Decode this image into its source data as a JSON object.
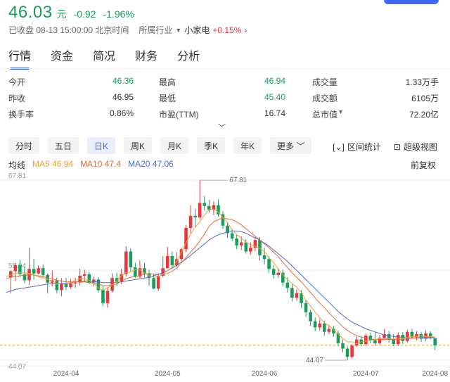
{
  "header": {
    "price": "46.03",
    "unit": "元",
    "change": "-0.92",
    "change_pct": "-1.96%",
    "status": "已收盘 08-13 15:00:00 北京时间",
    "industry_label": "所属行业",
    "industry_name": "小家电",
    "industry_change": "+0.15%"
  },
  "tabs": [
    "行情",
    "资金",
    "简况",
    "财务",
    "分析"
  ],
  "stats": [
    [
      {
        "label": "今开",
        "value": "46.36",
        "color": "green"
      },
      {
        "label": "最高",
        "value": "46.94",
        "color": "green"
      },
      {
        "label": "成交量",
        "value": "1.33万手",
        "color": ""
      }
    ],
    [
      {
        "label": "昨收",
        "value": "46.95",
        "color": ""
      },
      {
        "label": "最低",
        "value": "45.40",
        "color": "green"
      },
      {
        "label": "成交额",
        "value": "6105万",
        "color": ""
      }
    ],
    [
      {
        "label": "换手率",
        "value": "0.86%",
        "color": ""
      },
      {
        "label": "市盈(TTM)",
        "value": "16.74",
        "color": ""
      },
      {
        "label": "总市值",
        "value": "72.20亿",
        "color": ""
      }
    ]
  ],
  "expand_icon": "chevron-down",
  "periods": [
    "分时",
    "五日",
    "日K",
    "周K",
    "月K",
    "季K",
    "年K",
    "更多"
  ],
  "active_period": "日K",
  "tools": {
    "interval_stats": "区间统计",
    "super_view": "超级视图"
  },
  "legend": {
    "title": "均线",
    "ma5": "MA5 46.94",
    "ma10": "MA10 47.4",
    "ma20": "MA20 47.06",
    "adjust": "前复权"
  },
  "colors": {
    "up": "#e8373d",
    "down": "#1a9d5c",
    "ma5": "#e9a23b",
    "ma10": "#e8673d",
    "ma20": "#4b6bd6",
    "accent": "#3e66f3"
  },
  "chart_data": {
    "type": "candlestick",
    "y_range": [
      44.07,
      67.81
    ],
    "y_labels": [
      "67.81",
      "55.94",
      "44.07"
    ],
    "reference_line": 46.03,
    "max_marker": "67.81",
    "min_marker": "44.07",
    "x_ticks": [
      "2024-04",
      "2024-05",
      "2024-06",
      "2024-07",
      "2024-08"
    ],
    "candles": [
      [
        55.0,
        55.8,
        53.2,
        52.9,
        55.9
      ],
      [
        55.8,
        56.6,
        55.0,
        54.5,
        56.9
      ],
      [
        56.6,
        55.4,
        56.7,
        55.0,
        57.3
      ],
      [
        55.4,
        54.6,
        55.8,
        54.2,
        56.4
      ],
      [
        54.6,
        56.1,
        54.4,
        54.0,
        58.9
      ],
      [
        56.1,
        55.5,
        56.4,
        54.7,
        57.4
      ],
      [
        55.5,
        56.2,
        55.9,
        55.4,
        56.6
      ],
      [
        56.2,
        55.3,
        56.4,
        55.0,
        56.7
      ],
      [
        55.3,
        54.3,
        55.4,
        52.9,
        55.5
      ],
      [
        54.3,
        54.6,
        54.0,
        53.8,
        55.9
      ],
      [
        54.6,
        53.3,
        54.8,
        52.9,
        55.0
      ],
      [
        53.3,
        54.1,
        53.1,
        52.5,
        54.9
      ],
      [
        54.1,
        53.7,
        54.2,
        53.3,
        54.9
      ],
      [
        53.7,
        54.2,
        53.8,
        53.5,
        54.8
      ],
      [
        54.2,
        54.3,
        54.5,
        53.6,
        54.9
      ],
      [
        54.3,
        55.2,
        54.2,
        53.9,
        56.1
      ],
      [
        55.2,
        55.4,
        55.3,
        54.5,
        56.0
      ],
      [
        55.4,
        54.3,
        55.5,
        54.1,
        55.7
      ],
      [
        54.3,
        54.7,
        54.3,
        53.8,
        55.1
      ],
      [
        54.7,
        53.3,
        54.8,
        53.0,
        55.0
      ],
      [
        53.3,
        51.6,
        53.6,
        51.2,
        53.9
      ],
      [
        51.6,
        53.2,
        51.4,
        51.0,
        53.7
      ],
      [
        53.2,
        54.9,
        53.3,
        53.0,
        55.5
      ],
      [
        54.9,
        54.4,
        55.1,
        53.8,
        55.6
      ],
      [
        54.4,
        55.4,
        54.5,
        54.1,
        56.1
      ],
      [
        55.4,
        58.4,
        55.5,
        55.1,
        59.1
      ],
      [
        58.4,
        56.3,
        58.5,
        55.8,
        58.8
      ],
      [
        56.3,
        55.1,
        56.1,
        54.9,
        56.9
      ],
      [
        55.1,
        56.2,
        55.2,
        54.9,
        57.2
      ],
      [
        56.2,
        55.5,
        56.0,
        55.0,
        56.9
      ],
      [
        55.5,
        54.9,
        55.6,
        53.9,
        56.0
      ],
      [
        54.9,
        53.5,
        55.0,
        53.4,
        55.4
      ],
      [
        53.5,
        55.2,
        53.6,
        53.2,
        55.5
      ],
      [
        55.2,
        56.2,
        55.4,
        55.0,
        57.8
      ],
      [
        56.2,
        57.8,
        56.4,
        56.2,
        59.0
      ],
      [
        57.8,
        56.6,
        57.9,
        56.2,
        58.4
      ],
      [
        56.6,
        57.4,
        56.8,
        56.4,
        58.3
      ],
      [
        57.4,
        58.7,
        57.5,
        57.1,
        58.9
      ],
      [
        58.7,
        61.5,
        58.9,
        58.3,
        61.9
      ],
      [
        61.5,
        63.1,
        61.7,
        60.8,
        64.5
      ],
      [
        63.1,
        62.9,
        63.0,
        61.6,
        64.0
      ],
      [
        62.9,
        64.8,
        62.9,
        62.6,
        67.8
      ],
      [
        64.8,
        64.4,
        65.0,
        63.8,
        65.7
      ],
      [
        64.4,
        63.9,
        64.6,
        63.5,
        65.2
      ],
      [
        63.9,
        64.5,
        63.8,
        63.2,
        65.0
      ],
      [
        64.5,
        63.3,
        64.7,
        63.0,
        65.3
      ],
      [
        63.3,
        61.8,
        63.4,
        61.4,
        63.7
      ],
      [
        61.8,
        60.8,
        62.0,
        60.2,
        62.3
      ],
      [
        60.8,
        60.1,
        61.0,
        59.8,
        61.4
      ],
      [
        60.1,
        59.2,
        60.3,
        58.7,
        60.6
      ],
      [
        59.2,
        59.6,
        59.1,
        58.6,
        60.4
      ],
      [
        59.6,
        58.4,
        59.7,
        58.1,
        60.0
      ],
      [
        58.4,
        58.9,
        58.6,
        58.0,
        59.6
      ],
      [
        58.9,
        59.9,
        58.8,
        58.4,
        60.3
      ],
      [
        59.9,
        57.9,
        60.0,
        57.2,
        60.3
      ],
      [
        57.9,
        57.4,
        58.1,
        56.7,
        58.9
      ],
      [
        57.4,
        56.1,
        57.6,
        55.6,
        57.8
      ],
      [
        56.1,
        55.3,
        56.3,
        54.8,
        56.6
      ],
      [
        55.3,
        55.6,
        55.4,
        54.9,
        56.2
      ],
      [
        55.6,
        54.3,
        55.7,
        53.8,
        56.0
      ],
      [
        54.3,
        53.6,
        54.5,
        53.0,
        55.0
      ],
      [
        53.6,
        52.3,
        53.8,
        51.8,
        54.1
      ],
      [
        52.3,
        52.9,
        52.2,
        51.9,
        53.4
      ],
      [
        52.9,
        51.6,
        53.0,
        51.0,
        53.3
      ],
      [
        51.6,
        50.4,
        51.8,
        49.8,
        52.0
      ],
      [
        50.4,
        49.2,
        50.6,
        48.6,
        50.7
      ],
      [
        49.2,
        48.4,
        49.4,
        47.9,
        49.7
      ],
      [
        48.4,
        48.9,
        48.3,
        48.0,
        49.5
      ],
      [
        48.9,
        47.8,
        49.0,
        47.3,
        49.3
      ],
      [
        47.8,
        48.2,
        47.9,
        47.5,
        48.7
      ],
      [
        48.2,
        47.6,
        48.3,
        47.2,
        48.6
      ],
      [
        47.6,
        46.3,
        47.8,
        45.9,
        48.0
      ],
      [
        46.3,
        45.6,
        46.5,
        45.1,
        46.8
      ],
      [
        45.6,
        44.5,
        45.8,
        44.07,
        45.9
      ],
      [
        44.5,
        46.0,
        44.6,
        44.3,
        46.2
      ],
      [
        46.0,
        46.8,
        46.1,
        45.8,
        47.2
      ],
      [
        46.8,
        46.2,
        46.9,
        45.9,
        47.3
      ],
      [
        46.2,
        47.3,
        46.3,
        46.0,
        47.6
      ],
      [
        47.3,
        46.7,
        47.4,
        46.3,
        47.7
      ],
      [
        46.7,
        46.3,
        46.9,
        46.0,
        47.8
      ],
      [
        46.3,
        47.0,
        46.4,
        46.1,
        47.4
      ],
      [
        47.0,
        47.5,
        47.2,
        46.8,
        48.2
      ],
      [
        47.5,
        46.8,
        47.6,
        46.4,
        47.9
      ],
      [
        46.8,
        46.2,
        46.9,
        45.9,
        47.5
      ],
      [
        46.2,
        47.4,
        46.3,
        46.0,
        47.7
      ],
      [
        47.4,
        46.6,
        47.5,
        46.2,
        47.8
      ],
      [
        46.6,
        47.8,
        46.7,
        46.4,
        48.1
      ],
      [
        47.8,
        47.1,
        47.9,
        46.8,
        48.2
      ],
      [
        47.1,
        47.5,
        47.2,
        46.7,
        47.9
      ],
      [
        47.5,
        46.9,
        47.6,
        46.5,
        47.8
      ],
      [
        46.9,
        47.6,
        47.0,
        46.6,
        48.0
      ],
      [
        47.6,
        47.0,
        47.7,
        46.8,
        47.9
      ],
      [
        46.95,
        46.03,
        46.36,
        45.4,
        46.94
      ]
    ],
    "ma5": [
      55.1,
      55.3,
      55.5,
      55.6,
      55.6,
      55.5,
      55.3,
      55.1,
      54.9,
      54.7,
      54.5,
      54.2,
      54.1,
      54.1,
      54.3,
      54.6,
      54.8,
      54.8,
      54.6,
      54.2,
      53.6,
      53.3,
      53.6,
      54.0,
      54.5,
      55.2,
      55.6,
      55.7,
      56.0,
      56.0,
      55.6,
      55.2,
      55.0,
      55.1,
      55.4,
      55.9,
      56.3,
      57.1,
      58.3,
      59.5,
      60.7,
      61.6,
      62.3,
      63.2,
      63.9,
      64.0,
      63.6,
      62.9,
      62.2,
      61.3,
      60.6,
      60.2,
      59.6,
      59.3,
      59.1,
      58.8,
      58.4,
      57.6,
      56.9,
      56.1,
      55.3,
      54.7,
      54.2,
      53.7,
      53.0,
      52.0,
      51.2,
      50.4,
      49.7,
      49.0,
      48.6,
      48.1,
      47.5,
      46.9,
      46.5,
      46.5,
      46.2,
      46.5,
      46.6,
      46.7,
      46.8,
      46.9,
      46.9,
      46.9,
      46.9,
      47.0,
      46.9,
      47.1,
      47.2,
      47.2,
      47.3,
      47.2,
      47.2,
      47.1
    ],
    "ma10": [
      54.8,
      55.0,
      55.1,
      55.2,
      55.3,
      55.3,
      55.3,
      55.2,
      55.1,
      54.9,
      54.8,
      54.6,
      54.5,
      54.4,
      54.4,
      54.4,
      54.4,
      54.4,
      54.3,
      54.2,
      54.1,
      53.9,
      53.9,
      54.0,
      54.1,
      54.5,
      54.8,
      55.0,
      55.1,
      55.2,
      55.4,
      55.5,
      55.4,
      55.4,
      55.4,
      55.5,
      55.8,
      56.2,
      56.9,
      57.6,
      58.3,
      59.0,
      59.8,
      60.7,
      61.7,
      62.3,
      62.6,
      62.8,
      62.7,
      62.6,
      62.3,
      61.9,
      61.4,
      60.9,
      60.4,
      59.9,
      59.4,
      58.9,
      58.3,
      57.7,
      57.0,
      56.3,
      55.6,
      55.0,
      54.4,
      53.7,
      53.0,
      52.3,
      51.6,
      51.0,
      50.3,
      49.7,
      49.1,
      48.5,
      48.0,
      47.6,
      47.3,
      47.1,
      47.0,
      46.9,
      46.8,
      46.8,
      46.8,
      46.8,
      46.8,
      46.8,
      46.8,
      46.9,
      47.0,
      47.0,
      47.1,
      47.1,
      47.1,
      47.1
    ],
    "ma20": [
      53.0,
      53.2,
      53.4,
      53.5,
      53.6,
      53.7,
      53.8,
      53.9,
      54.0,
      54.1,
      54.1,
      54.2,
      54.2,
      54.2,
      54.3,
      54.4,
      54.4,
      54.5,
      54.5,
      54.4,
      54.4,
      54.3,
      54.3,
      54.3,
      54.3,
      54.4,
      54.5,
      54.6,
      54.7,
      54.8,
      54.9,
      55.0,
      55.2,
      55.4,
      55.6,
      55.9,
      56.2,
      56.6,
      57.0,
      57.4,
      57.9,
      58.4,
      58.9,
      59.4,
      59.9,
      60.3,
      60.6,
      60.8,
      61.0,
      61.1,
      61.1,
      61.0,
      60.8,
      60.5,
      60.2,
      59.9,
      59.5,
      59.1,
      58.6,
      58.1,
      57.6,
      57.1,
      56.5,
      55.9,
      55.3,
      54.7,
      54.1,
      53.5,
      52.9,
      52.3,
      51.7,
      51.1,
      50.5,
      50.0,
      49.5,
      49.1,
      48.8,
      48.5,
      48.2,
      48.0,
      47.8,
      47.6,
      47.4,
      47.3,
      47.2,
      47.1,
      47.1,
      47.0,
      47.0,
      47.0,
      47.0,
      47.0,
      47.0,
      47.06
    ]
  }
}
